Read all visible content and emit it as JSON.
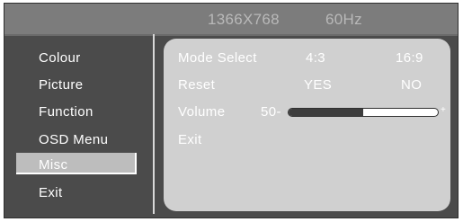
{
  "header": {
    "resolution": "1366X768",
    "refresh": "60Hz"
  },
  "menu": {
    "items": [
      {
        "label": "Colour"
      },
      {
        "label": "Picture"
      },
      {
        "label": "Function"
      },
      {
        "label": "OSD Menu"
      },
      {
        "label": "Misc",
        "selected": true
      },
      {
        "label": "Exit"
      }
    ]
  },
  "misc": {
    "mode_select": {
      "label": "Mode Select",
      "option_a": "4:3",
      "option_b": "16:9"
    },
    "reset": {
      "label": "Reset",
      "option_yes": "YES",
      "option_no": "NO"
    },
    "volume": {
      "label": "Volume",
      "value_text": "50-",
      "plus": "+",
      "level": 0.5
    },
    "exit": {
      "label": "Exit"
    }
  },
  "colors": {
    "panel": "#d0d0d0",
    "background": "#4b4b4b",
    "header": "#7c7c7c"
  }
}
